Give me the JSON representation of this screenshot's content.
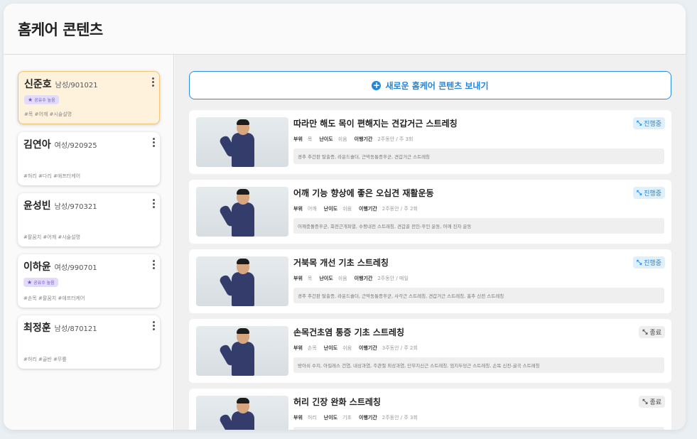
{
  "header": {
    "title": "홈케어 콘텐츠"
  },
  "patients": [
    {
      "name": "신준호",
      "meta": "남성/901021",
      "badge": "공유수 높음",
      "tags": "#목 #어깨 #시술설명",
      "selected": true
    },
    {
      "name": "김연아",
      "meta": "여성/920925",
      "badge": "",
      "tags": "#허리 #다리 #애프터케어",
      "selected": false
    },
    {
      "name": "윤성빈",
      "meta": "남성/970321",
      "badge": "",
      "tags": "#팔꿈치 #어깨 #시술설명",
      "selected": false
    },
    {
      "name": "이하윤",
      "meta": "여성/990701",
      "badge": "공유수 높음",
      "tags": "#손목 #팔꿈치 #애프터케어",
      "selected": false
    },
    {
      "name": "최정훈",
      "meta": "남성/870121",
      "badge": "",
      "tags": "#허리 #골반 #무릎",
      "selected": false
    }
  ],
  "main": {
    "new_button_label": "새로운 홈케어 콘텐츠 보내기",
    "info_labels": {
      "part": "부위",
      "difficulty": "난이도",
      "period": "이행기간"
    },
    "contents": [
      {
        "title": "따라만 해도 목이 편해지는 견갑거근 스트레칭",
        "status": "진행중",
        "status_type": "progress",
        "part": "목",
        "difficulty": "쉬움",
        "period": "2주동안 / 주 3회",
        "desc": "경추 추간판 탈출증, 라운드숄더, 근막동통증후군, 견갑거근 스트레칭"
      },
      {
        "title": "어깨 기능 향상에 좋은 오십견 재활운동",
        "status": "진행중",
        "status_type": "progress",
        "part": "어깨",
        "difficulty": "쉬움",
        "period": "2주동안 / 주 2회",
        "desc": "어깨충돌증후군, 회전근개파열, 수평내전 스트레칭, 견갑골 전인-후인 운동, 어깨 진자 운동"
      },
      {
        "title": "거북목 개선 기초 스트레칭",
        "status": "진행중",
        "status_type": "progress",
        "part": "목",
        "difficulty": "쉬움",
        "period": "2주동안 / 매일",
        "desc": "경추 추간판 탈출증, 라운드숄더, 근막동통증후군, 사각근 스트레칭, 견갑거근 스트레칭, 흉추 신전 스트레칭"
      },
      {
        "title": "손목건초염 통증 기초 스트레칭",
        "status": "종료",
        "status_type": "done",
        "part": "손목",
        "difficulty": "쉬움",
        "period": "3주동안 / 주 2회",
        "desc": "방아쇠 수지, 아킬레스 건염, 내상과염, 주관절 외상과염, 단무지신근 스트레칭, 엄지두덩근 스트레칭, 손목 신전-굴곡 스트레칭"
      },
      {
        "title": "허리 긴장 완화 스트레칭",
        "status": "종료",
        "status_type": "done",
        "part": "허리",
        "difficulty": "기초",
        "period": "2주동안 / 주 3회",
        "desc": ""
      }
    ]
  },
  "colors": {
    "accent": "#1f86e2",
    "selected_bg": "#fef2dc",
    "badge_bg": "#e3dbfb"
  },
  "icons": {
    "menu": "kebab-menu-icon",
    "plus": "plus-circle-icon",
    "status": "arrows-icon",
    "star": "star-icon"
  }
}
